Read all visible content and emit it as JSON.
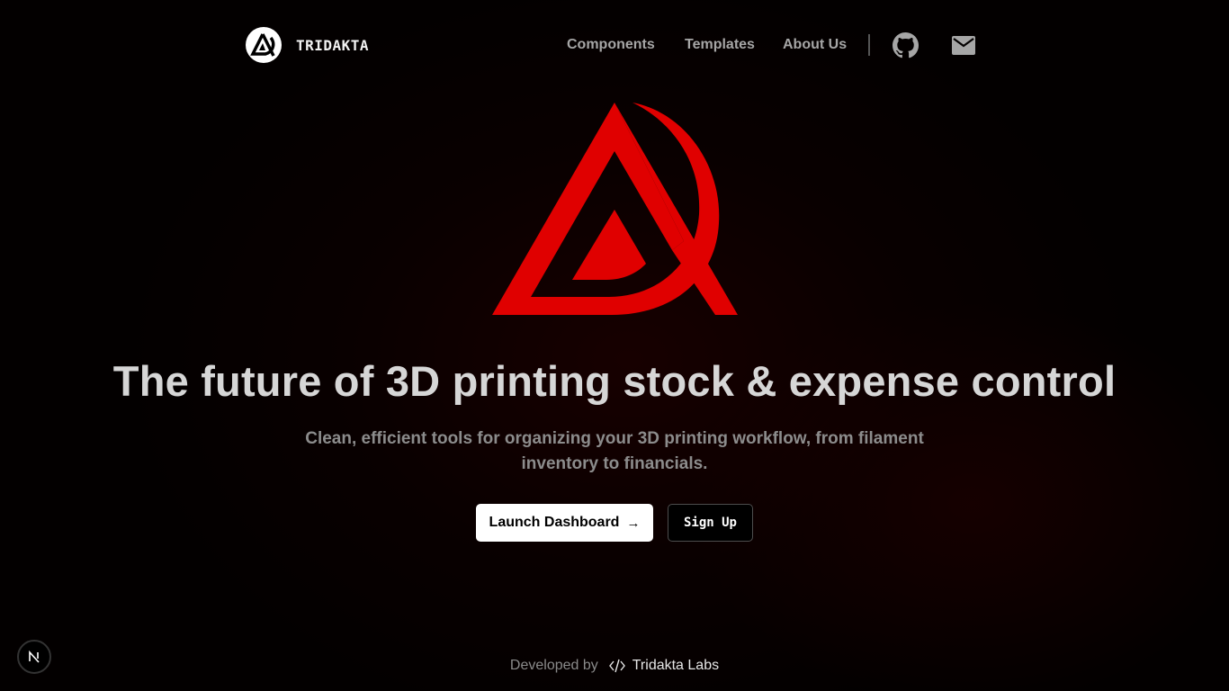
{
  "header": {
    "brand_name": "TRIDAKTA",
    "nav": [
      {
        "label": "Components"
      },
      {
        "label": "Templates"
      },
      {
        "label": "About Us"
      }
    ],
    "icons": {
      "github": "github-icon",
      "mail": "mail-icon"
    }
  },
  "hero": {
    "logo": "tridakta-logo",
    "headline": "The future of 3D printing stock & expense control",
    "subline": "Clean, efficient tools for organizing your 3D printing workflow, from filament inventory to financials.",
    "primary_button": "Launch Dashboard",
    "primary_button_icon": "→",
    "secondary_button": "Sign Up"
  },
  "footer": {
    "prefix": "Developed by",
    "code_icon": "</>",
    "link": "Tridakta Labs"
  },
  "dev_badge": {
    "label": "N"
  },
  "colors": {
    "accent": "#e00000",
    "background": "#030000",
    "headline": "#d6d6d6",
    "nav": "#a6a6a6"
  }
}
